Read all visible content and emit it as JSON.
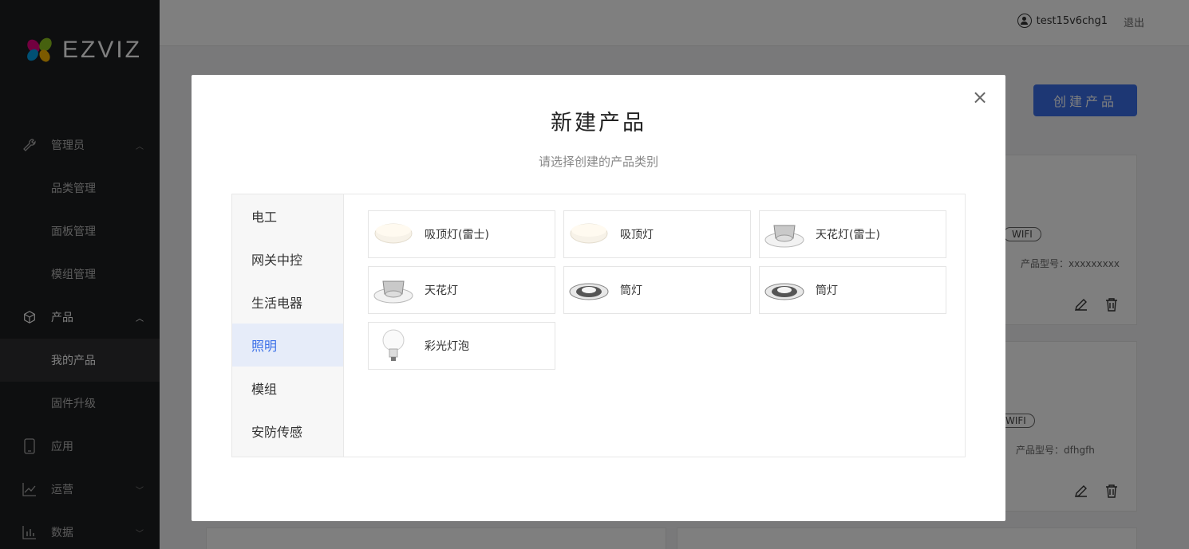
{
  "brand": {
    "logo_text": "EZVIZ"
  },
  "sidebar": {
    "items": [
      {
        "label": "管理员",
        "icon": "wrench-icon",
        "expanded": true
      },
      {
        "label": "品类管理"
      },
      {
        "label": "面板管理"
      },
      {
        "label": "模组管理"
      },
      {
        "label": "产品",
        "icon": "cube-icon",
        "expanded": true
      },
      {
        "label": "我的产品"
      },
      {
        "label": "固件升级"
      },
      {
        "label": "应用",
        "icon": "phone-icon"
      },
      {
        "label": "运营",
        "icon": "line-chart-icon",
        "expanded": false
      },
      {
        "label": "数据",
        "icon": "bar-chart-icon",
        "expanded": false
      }
    ]
  },
  "header": {
    "username": "test15v6chg1",
    "logout_label": "退出"
  },
  "main": {
    "create_button": "创建产品",
    "cards": [
      {
        "tag": "WIFI",
        "model": "产品型号：xxxxxxxxx"
      },
      {
        "tag": "WIFI",
        "model": "产品型号：dfhgfh"
      }
    ]
  },
  "modal": {
    "title": "新建产品",
    "subtitle": "请选择创建的产品类别",
    "close_symbol": "×",
    "categories": [
      "电工",
      "网关中控",
      "生活电器",
      "照明",
      "模组",
      "安防传感"
    ],
    "active_category": "照明",
    "products": [
      {
        "name": "吸顶灯(雷士)",
        "icon": "ceiling-light-icon"
      },
      {
        "name": "吸顶灯",
        "icon": "ceiling-light-icon"
      },
      {
        "name": "天花灯(雷士)",
        "icon": "ceiling-spot-icon"
      },
      {
        "name": "天花灯",
        "icon": "ceiling-spot-icon"
      },
      {
        "name": "筒灯",
        "icon": "downlight-icon"
      },
      {
        "name": "筒灯",
        "icon": "downlight-icon"
      },
      {
        "name": "彩光灯泡",
        "icon": "bulb-icon"
      }
    ]
  },
  "colors": {
    "accent": "#3a6fe8",
    "sidebar_bg": "#1d1e20",
    "active_cat_bg": "#e6ecf9"
  }
}
